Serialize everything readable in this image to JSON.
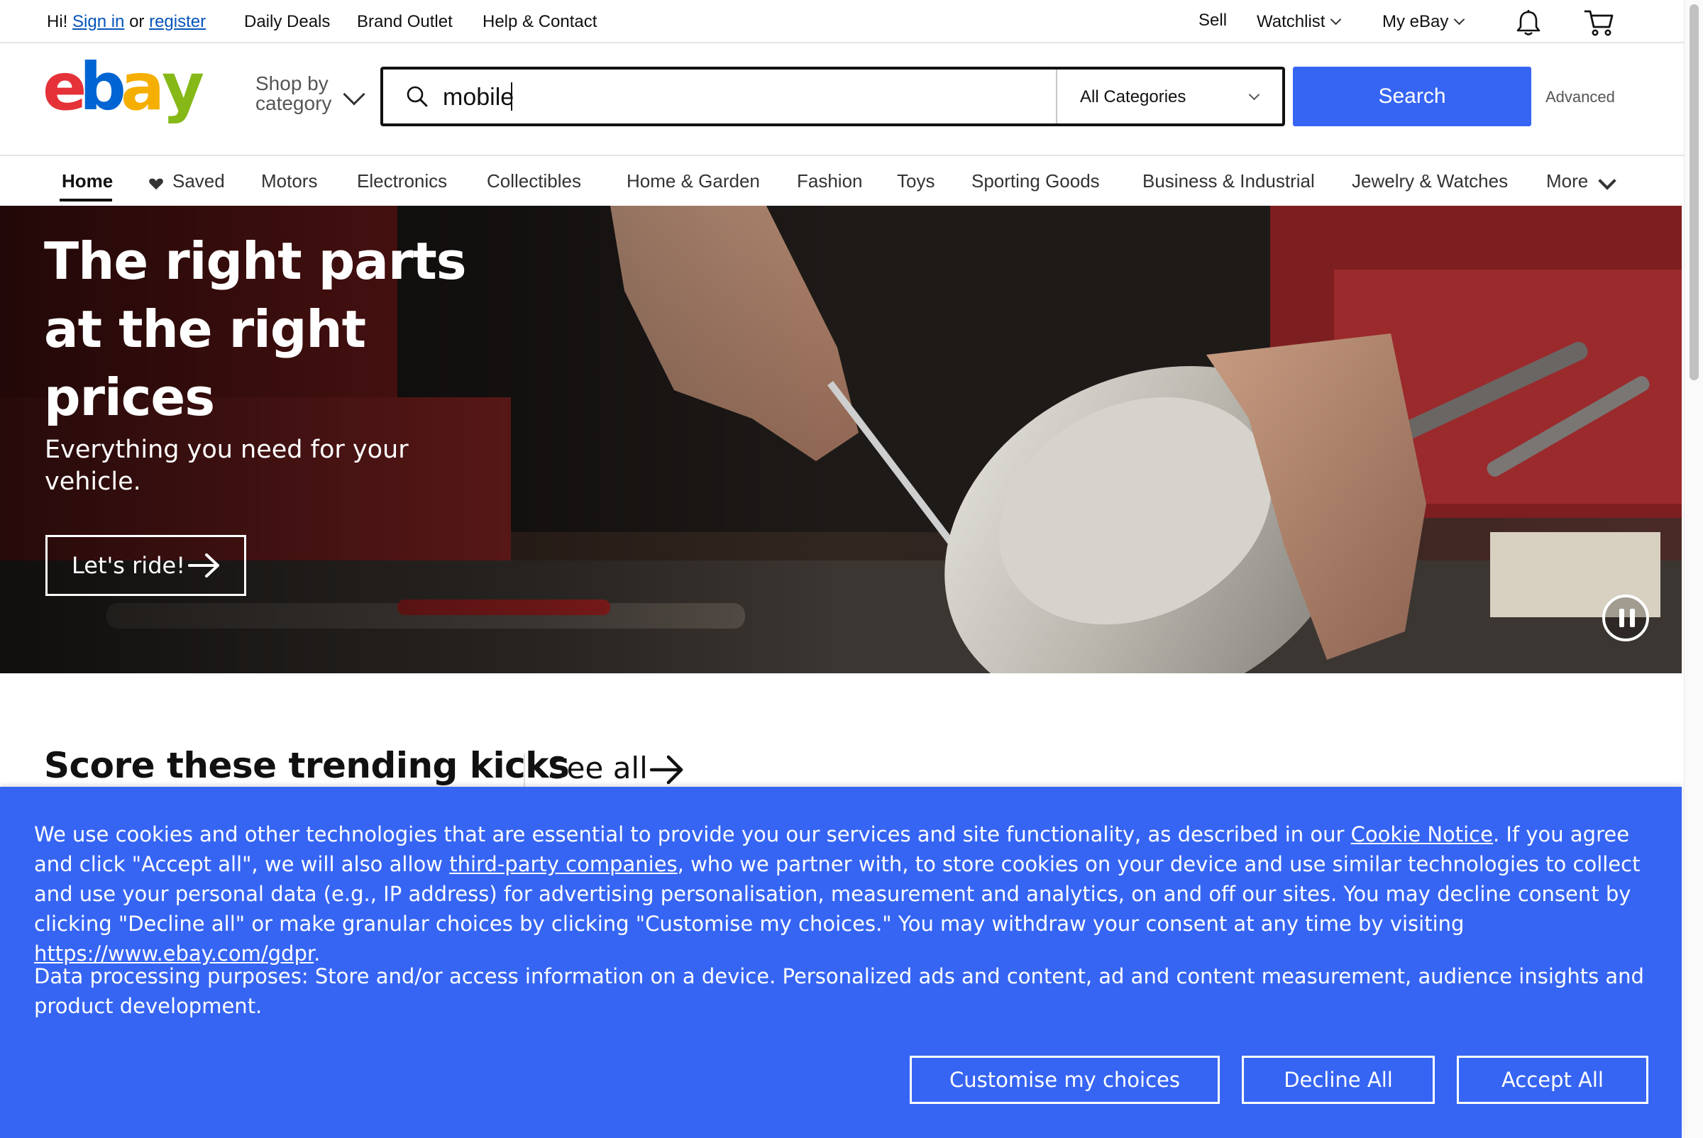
{
  "topbar": {
    "greeting": "Hi!",
    "sign_in": "Sign in",
    "or": "or",
    "register": "register",
    "daily_deals": "Daily Deals",
    "brand_outlet": "Brand Outlet",
    "help_contact": "Help & Contact",
    "sell": "Sell",
    "watchlist": "Watchlist",
    "my_ebay": "My eBay"
  },
  "header": {
    "logo_letters": [
      "e",
      "b",
      "a",
      "y"
    ],
    "logo_colors": [
      "#e53238",
      "#0064d2",
      "#f5af02",
      "#86b817"
    ],
    "shop_by_line1": "Shop by",
    "shop_by_line2": "category",
    "search_value": "mobile",
    "category_select": "All Categories",
    "search_button": "Search",
    "advanced": "Advanced",
    "accent": "#3665f3"
  },
  "nav": {
    "items": [
      "Home",
      "Saved",
      "Motors",
      "Electronics",
      "Collectibles",
      "Home & Garden",
      "Fashion",
      "Toys",
      "Sporting Goods",
      "Business & Industrial",
      "Jewelry & Watches",
      "More"
    ]
  },
  "hero": {
    "title": "The right parts at the right prices",
    "subtitle": "Everything you need for your vehicle.",
    "cta": "Let's ride!"
  },
  "trending": {
    "title": "Score these trending kicks",
    "see_all": "See all"
  },
  "cookie": {
    "p1_a": "We use cookies and other technologies that are essential to provide you our services and site functionality, as described in our ",
    "cookie_notice": "Cookie Notice",
    "p1_b": ". If you agree and click \"Accept all\", we will also allow ",
    "third_party": "third-party companies",
    "p1_c": ", who we partner with, to store cookies on your device and use similar technologies to collect and use your personal data (e.g., IP address) for advertising personalisation, measurement and analytics, on and off our sites. You may decline consent by clicking \"Decline all\" or make granular choices by clicking \"Customise my choices.\" You may withdraw your consent at any time by visiting ",
    "gdpr_link": "https://www.ebay.com/gdpr",
    "p1_d": ".",
    "p2": "Data processing purposes: Store and/or access information on a device. Personalized ads and content, ad and content measurement, audience insights and product development.",
    "customise": "Customise my choices",
    "decline": "Decline All",
    "accept": "Accept All"
  }
}
